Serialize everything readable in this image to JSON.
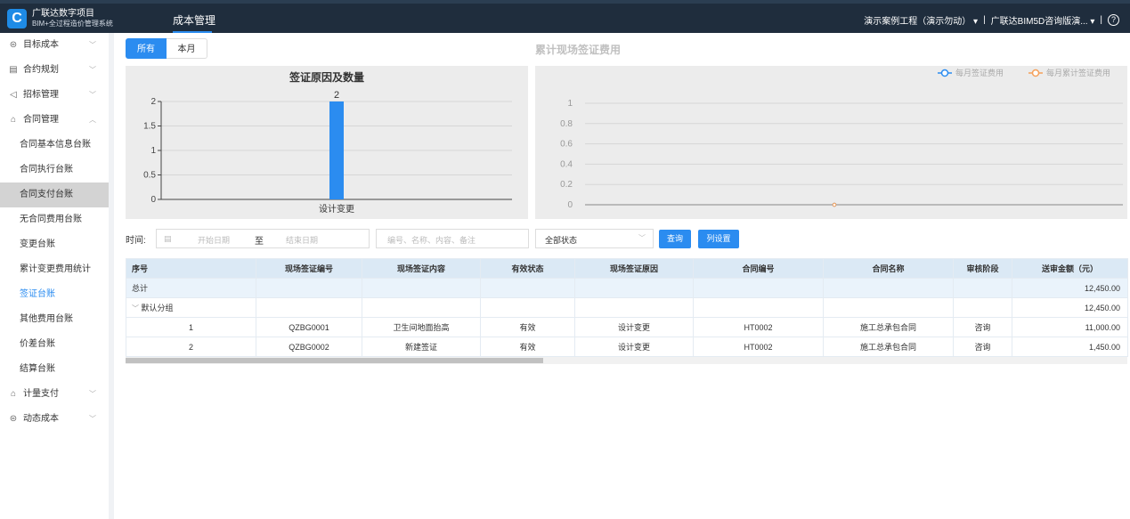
{
  "header": {
    "logo_letter": "C",
    "brand_line1": "广联达数字项目",
    "brand_line2": "BIM+全过程造价管理系统",
    "module": "成本管理",
    "project": "演示案例工程（演示勿动）",
    "org": "广联达BIM5D咨询版演...",
    "sep": "|"
  },
  "sidebar": {
    "items": [
      {
        "label": "目标成本",
        "type": "group",
        "icon": "layers-icon",
        "glyph": "⊜",
        "chevron": "﹀"
      },
      {
        "label": "合约规划",
        "type": "group",
        "icon": "document-icon",
        "glyph": "▤",
        "chevron": "﹀"
      },
      {
        "label": "招标管理",
        "type": "group",
        "icon": "send-icon",
        "glyph": "◁",
        "chevron": "﹀"
      },
      {
        "label": "合同管理",
        "type": "group",
        "icon": "folder-icon",
        "glyph": "⌂",
        "chevron": "︿"
      },
      {
        "label": "合同基本信息台账",
        "type": "sub"
      },
      {
        "label": "合同执行台账",
        "type": "sub"
      },
      {
        "label": "合同支付台账",
        "type": "sub",
        "state": "active"
      },
      {
        "label": "无合同费用台账",
        "type": "sub"
      },
      {
        "label": "变更台账",
        "type": "sub"
      },
      {
        "label": "累计变更费用统计",
        "type": "sub"
      },
      {
        "label": "签证台账",
        "type": "sub",
        "state": "current"
      },
      {
        "label": "其他费用台账",
        "type": "sub"
      },
      {
        "label": "价差台账",
        "type": "sub"
      },
      {
        "label": "结算台账",
        "type": "sub"
      },
      {
        "label": "计量支付",
        "type": "group",
        "icon": "folder-icon",
        "glyph": "⌂",
        "chevron": "﹀"
      },
      {
        "label": "动态成本",
        "type": "group",
        "icon": "database-icon",
        "glyph": "⊜",
        "chevron": "﹀"
      }
    ]
  },
  "tabs": {
    "all": "所有",
    "month": "本月"
  },
  "chart1": {
    "title": "签证原因及数量",
    "chart_data": {
      "type": "bar",
      "title": "签证原因及数量",
      "categories": [
        "设计变更"
      ],
      "values": [
        2
      ],
      "data_labels": [
        "2"
      ],
      "yticks": [
        "0",
        "0.5",
        "1",
        "1.5",
        "2"
      ],
      "ylim": [
        0,
        2
      ],
      "bar_color": "#2b8cf0",
      "grid": true
    }
  },
  "chart2": {
    "section_title": "累计现场签证费用",
    "legend1": "每月签证费用",
    "legend2": "每月累计签证费用",
    "chart_data": {
      "type": "line",
      "series": [
        {
          "name": "每月签证费用",
          "values": [
            0
          ],
          "color": "#2b8cf0"
        },
        {
          "name": "每月累计签证费用",
          "values": [
            0
          ],
          "color": "#f5a05a"
        }
      ],
      "yticks": [
        "0",
        "0.2",
        "0.4",
        "0.6",
        "0.8",
        "1"
      ],
      "ylim": [
        0,
        1
      ],
      "legend": "top-right",
      "grid": true
    }
  },
  "filters": {
    "time_label": "时间:",
    "start_placeholder": "开始日期",
    "to": "至",
    "end_placeholder": "结束日期",
    "keyword_placeholder": "编号、名称、内容、备注",
    "status": "全部状态",
    "query": "查询",
    "columns": "列设置"
  },
  "table": {
    "headers": [
      "序号",
      "现场签证编号",
      "现场签证内容",
      "有效状态",
      "现场签证原因",
      "合同编号",
      "合同名称",
      "审核阶段",
      "送审金额（元）"
    ],
    "total_label": "总计",
    "total_amount": "12,450.00",
    "group_label": "默认分组",
    "group_amount": "12,450.00",
    "rows": [
      {
        "no": "1",
        "code": "QZBG0001",
        "content": "卫生间地面抬高",
        "status": "有效",
        "reason": "设计变更",
        "contract_no": "HT0002",
        "contract_name": "施工总承包合同",
        "stage": "咨询",
        "amount": "11,000.00"
      },
      {
        "no": "2",
        "code": "QZBG0002",
        "content": "新建签证",
        "status": "有效",
        "reason": "设计变更",
        "contract_no": "HT0002",
        "contract_name": "施工总承包合同",
        "stage": "咨询",
        "amount": "1,450.00"
      }
    ]
  }
}
